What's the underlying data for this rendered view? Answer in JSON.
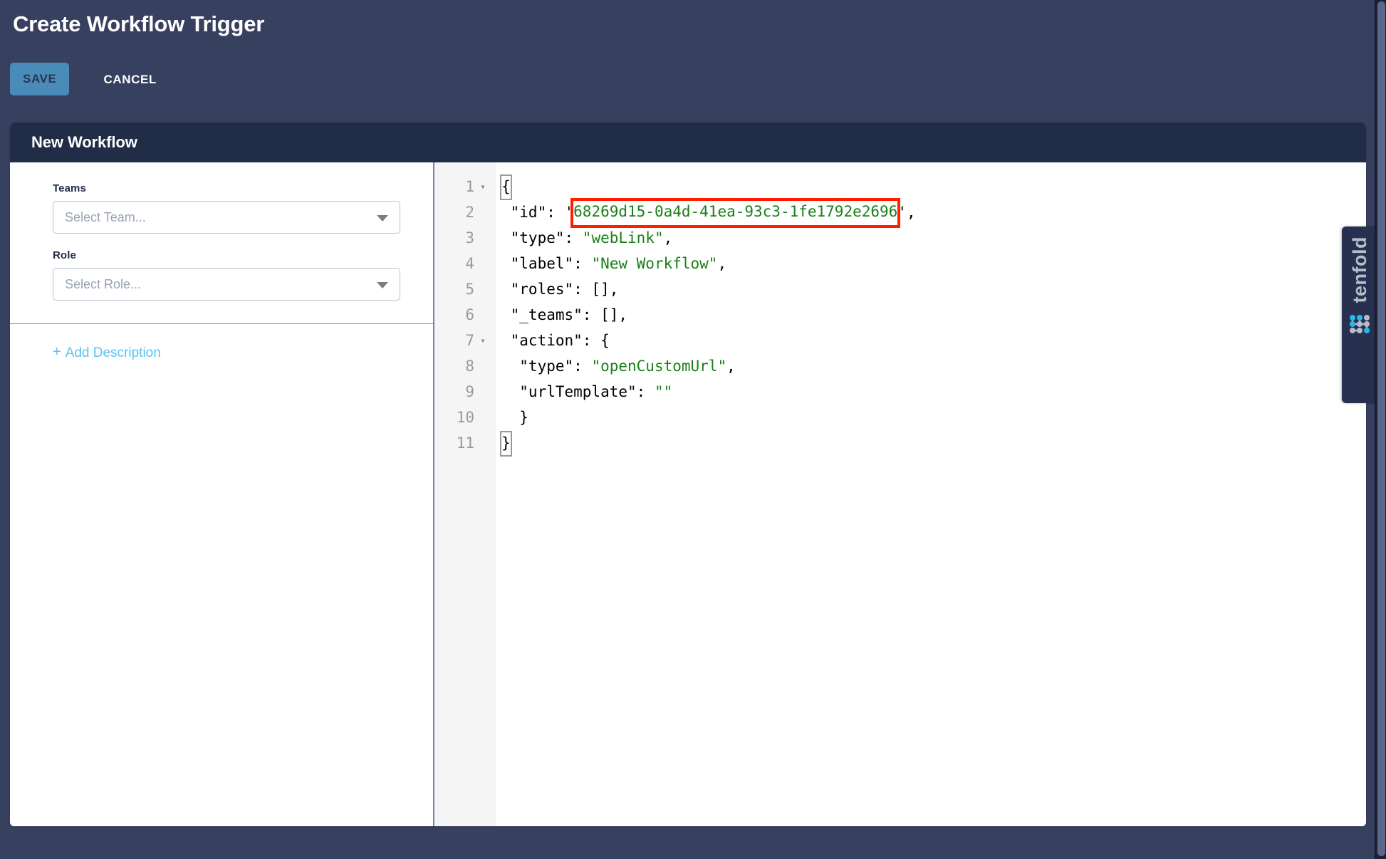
{
  "page": {
    "title": "Create Workflow Trigger",
    "background_color": "#37405f"
  },
  "actions": {
    "save_label": "SAVE",
    "cancel_label": "CANCEL",
    "save_color": "#4a8cb9"
  },
  "card": {
    "header_title": "New Workflow",
    "header_color": "#212c47"
  },
  "form": {
    "teams": {
      "label": "Teams",
      "placeholder": "Select Team...",
      "value": ""
    },
    "role": {
      "label": "Role",
      "placeholder": "Select Role...",
      "value": ""
    },
    "add_description_label": "Add Description",
    "add_description_plus": "+",
    "link_color": "#58c3f4"
  },
  "editor": {
    "line_numbers": [
      "1",
      "2",
      "3",
      "4",
      "5",
      "6",
      "7",
      "8",
      "9",
      "10",
      "11"
    ],
    "fold_arrows": [
      "▾",
      "",
      "",
      "",
      "",
      "",
      "▾",
      "",
      "",
      "",
      ""
    ],
    "string_color": "#1a8017",
    "highlight_border_color": "#ff1f00",
    "lines": [
      {
        "n": "1",
        "pre": "{",
        "str": "",
        "post": ""
      },
      {
        "n": "2",
        "pre": " \"id\": '",
        "str": "68269d15-0a4d-41ea-93c3-1fe1792e2696",
        "post": "',"
      },
      {
        "n": "3",
        "pre": " \"type\": ",
        "str": "\"webLink\"",
        "post": ","
      },
      {
        "n": "4",
        "pre": " \"label\": ",
        "str": "\"New Workflow\"",
        "post": ","
      },
      {
        "n": "5",
        "pre": " \"roles\": [],",
        "str": "",
        "post": ""
      },
      {
        "n": "6",
        "pre": " \"_teams\": [],",
        "str": "",
        "post": ""
      },
      {
        "n": "7",
        "pre": " \"action\": {",
        "str": "",
        "post": ""
      },
      {
        "n": "8",
        "pre": "  \"type\": ",
        "str": "\"openCustomUrl\"",
        "post": ","
      },
      {
        "n": "9",
        "pre": "  \"urlTemplate\": ",
        "str": "\"\"",
        "post": ""
      },
      {
        "n": "10",
        "pre": "  }",
        "str": "",
        "post": ""
      },
      {
        "n": "11",
        "pre": "}",
        "str": "",
        "post": ""
      }
    ],
    "json_content": {
      "id": "68269d15-0a4d-41ea-93c3-1fe1792e2696",
      "type": "webLink",
      "label": "New Workflow",
      "roles": "[]",
      "_teams": "[]",
      "action_type": "openCustomUrl",
      "action_urlTemplate": ""
    }
  },
  "branding": {
    "name": "tenfold",
    "dot_accent_color": "#27b9e8",
    "dot_gray_color": "#b6bcc9"
  }
}
